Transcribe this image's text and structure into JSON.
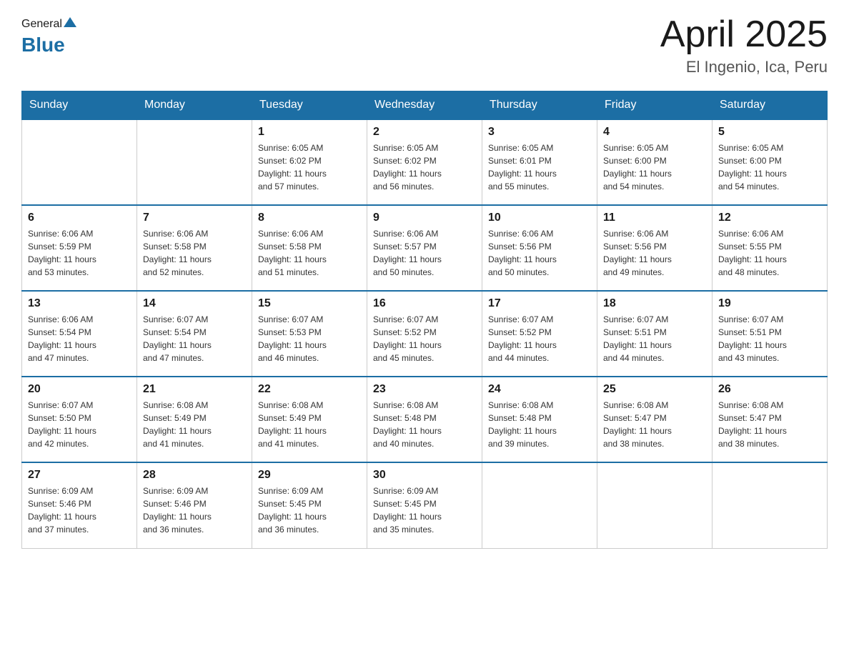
{
  "header": {
    "logo": {
      "text_general": "General",
      "text_blue": "Blue"
    },
    "title": "April 2025",
    "location": "El Ingenio, Ica, Peru"
  },
  "calendar": {
    "days_of_week": [
      "Sunday",
      "Monday",
      "Tuesday",
      "Wednesday",
      "Thursday",
      "Friday",
      "Saturday"
    ],
    "weeks": [
      [
        {
          "day": "",
          "info": ""
        },
        {
          "day": "",
          "info": ""
        },
        {
          "day": "1",
          "info": "Sunrise: 6:05 AM\nSunset: 6:02 PM\nDaylight: 11 hours\nand 57 minutes."
        },
        {
          "day": "2",
          "info": "Sunrise: 6:05 AM\nSunset: 6:02 PM\nDaylight: 11 hours\nand 56 minutes."
        },
        {
          "day": "3",
          "info": "Sunrise: 6:05 AM\nSunset: 6:01 PM\nDaylight: 11 hours\nand 55 minutes."
        },
        {
          "day": "4",
          "info": "Sunrise: 6:05 AM\nSunset: 6:00 PM\nDaylight: 11 hours\nand 54 minutes."
        },
        {
          "day": "5",
          "info": "Sunrise: 6:05 AM\nSunset: 6:00 PM\nDaylight: 11 hours\nand 54 minutes."
        }
      ],
      [
        {
          "day": "6",
          "info": "Sunrise: 6:06 AM\nSunset: 5:59 PM\nDaylight: 11 hours\nand 53 minutes."
        },
        {
          "day": "7",
          "info": "Sunrise: 6:06 AM\nSunset: 5:58 PM\nDaylight: 11 hours\nand 52 minutes."
        },
        {
          "day": "8",
          "info": "Sunrise: 6:06 AM\nSunset: 5:58 PM\nDaylight: 11 hours\nand 51 minutes."
        },
        {
          "day": "9",
          "info": "Sunrise: 6:06 AM\nSunset: 5:57 PM\nDaylight: 11 hours\nand 50 minutes."
        },
        {
          "day": "10",
          "info": "Sunrise: 6:06 AM\nSunset: 5:56 PM\nDaylight: 11 hours\nand 50 minutes."
        },
        {
          "day": "11",
          "info": "Sunrise: 6:06 AM\nSunset: 5:56 PM\nDaylight: 11 hours\nand 49 minutes."
        },
        {
          "day": "12",
          "info": "Sunrise: 6:06 AM\nSunset: 5:55 PM\nDaylight: 11 hours\nand 48 minutes."
        }
      ],
      [
        {
          "day": "13",
          "info": "Sunrise: 6:06 AM\nSunset: 5:54 PM\nDaylight: 11 hours\nand 47 minutes."
        },
        {
          "day": "14",
          "info": "Sunrise: 6:07 AM\nSunset: 5:54 PM\nDaylight: 11 hours\nand 47 minutes."
        },
        {
          "day": "15",
          "info": "Sunrise: 6:07 AM\nSunset: 5:53 PM\nDaylight: 11 hours\nand 46 minutes."
        },
        {
          "day": "16",
          "info": "Sunrise: 6:07 AM\nSunset: 5:52 PM\nDaylight: 11 hours\nand 45 minutes."
        },
        {
          "day": "17",
          "info": "Sunrise: 6:07 AM\nSunset: 5:52 PM\nDaylight: 11 hours\nand 44 minutes."
        },
        {
          "day": "18",
          "info": "Sunrise: 6:07 AM\nSunset: 5:51 PM\nDaylight: 11 hours\nand 44 minutes."
        },
        {
          "day": "19",
          "info": "Sunrise: 6:07 AM\nSunset: 5:51 PM\nDaylight: 11 hours\nand 43 minutes."
        }
      ],
      [
        {
          "day": "20",
          "info": "Sunrise: 6:07 AM\nSunset: 5:50 PM\nDaylight: 11 hours\nand 42 minutes."
        },
        {
          "day": "21",
          "info": "Sunrise: 6:08 AM\nSunset: 5:49 PM\nDaylight: 11 hours\nand 41 minutes."
        },
        {
          "day": "22",
          "info": "Sunrise: 6:08 AM\nSunset: 5:49 PM\nDaylight: 11 hours\nand 41 minutes."
        },
        {
          "day": "23",
          "info": "Sunrise: 6:08 AM\nSunset: 5:48 PM\nDaylight: 11 hours\nand 40 minutes."
        },
        {
          "day": "24",
          "info": "Sunrise: 6:08 AM\nSunset: 5:48 PM\nDaylight: 11 hours\nand 39 minutes."
        },
        {
          "day": "25",
          "info": "Sunrise: 6:08 AM\nSunset: 5:47 PM\nDaylight: 11 hours\nand 38 minutes."
        },
        {
          "day": "26",
          "info": "Sunrise: 6:08 AM\nSunset: 5:47 PM\nDaylight: 11 hours\nand 38 minutes."
        }
      ],
      [
        {
          "day": "27",
          "info": "Sunrise: 6:09 AM\nSunset: 5:46 PM\nDaylight: 11 hours\nand 37 minutes."
        },
        {
          "day": "28",
          "info": "Sunrise: 6:09 AM\nSunset: 5:46 PM\nDaylight: 11 hours\nand 36 minutes."
        },
        {
          "day": "29",
          "info": "Sunrise: 6:09 AM\nSunset: 5:45 PM\nDaylight: 11 hours\nand 36 minutes."
        },
        {
          "day": "30",
          "info": "Sunrise: 6:09 AM\nSunset: 5:45 PM\nDaylight: 11 hours\nand 35 minutes."
        },
        {
          "day": "",
          "info": ""
        },
        {
          "day": "",
          "info": ""
        },
        {
          "day": "",
          "info": ""
        }
      ]
    ]
  }
}
